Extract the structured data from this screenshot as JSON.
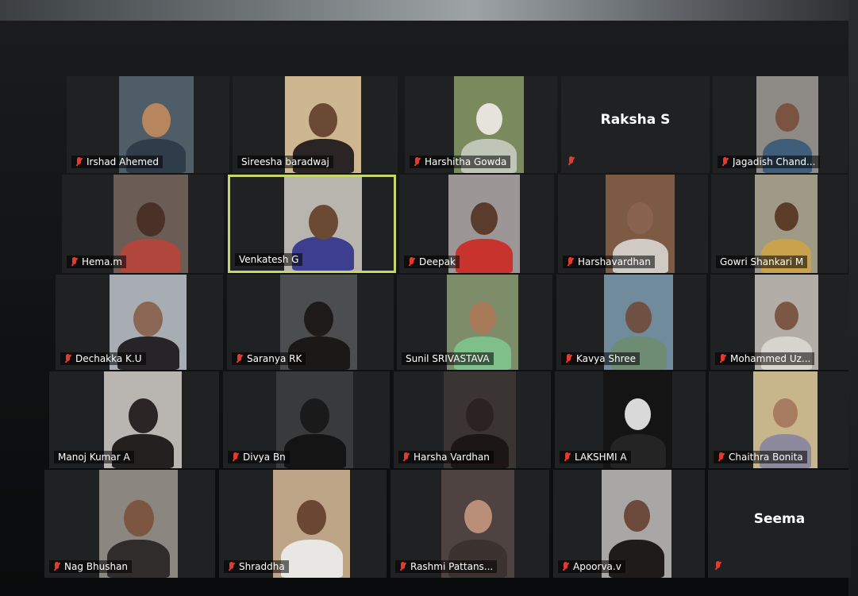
{
  "meeting": {
    "participants": [
      {
        "name": "Irshad Ahemed",
        "muted": true,
        "bg": "#4f5e66",
        "skin": "#b7855e",
        "shirt": "#2f3d4a"
      },
      {
        "name": "Sireesha baradwaj",
        "muted": false,
        "bg": "#cdb690",
        "skin": "#6a4a35",
        "shirt": "#2a2524"
      },
      {
        "name": "Harshitha Gowda",
        "muted": true,
        "bg": "#7a8a5c",
        "skin": "#e6e3dd",
        "shirt": "#c0c6b7"
      },
      {
        "name": "Raksha S",
        "muted": true,
        "video_off": true
      },
      {
        "name": "Jagadish Chand...",
        "muted": true,
        "bg": "#8e8b86",
        "skin": "#7a5441",
        "shirt": "#3e5e7c"
      },
      {
        "name": "Hema.m",
        "muted": true,
        "bg": "#6b5d55",
        "skin": "#4a3127",
        "shirt": "#b1463d"
      },
      {
        "name": "Venkatesh G",
        "muted": false,
        "active": true,
        "bg": "#b8b4ae",
        "skin": "#6b4a34",
        "shirt": "#3d3e8f"
      },
      {
        "name": "Deepak",
        "muted": true,
        "bg": "#9c9796",
        "skin": "#5a3c2c",
        "shirt": "#c9332e"
      },
      {
        "name": "Harshavardhan",
        "muted": true,
        "bg": "#7c5a44",
        "skin": "#8a6350",
        "shirt": "#cfcbc4"
      },
      {
        "name": "Gowri Shankari M",
        "muted": false,
        "bg": "#9f9a86",
        "skin": "#5b3d2a",
        "shirt": "#c9a24b"
      },
      {
        "name": "Dechakka K.U",
        "muted": true,
        "bg": "#a7adb2",
        "skin": "#8a6655",
        "shirt": "#262426"
      },
      {
        "name": "Saranya RK",
        "muted": true,
        "bg": "#4b4d4e",
        "skin": "#1d1a19",
        "shirt": "#1b1918"
      },
      {
        "name": "Sunil SRIVASTAVA",
        "muted": false,
        "bg": "#7d8d6a",
        "skin": "#a77a5a",
        "shirt": "#7fbf8a"
      },
      {
        "name": "Kavya Shree",
        "muted": true,
        "bg": "#6f8b9c",
        "skin": "#6e5142",
        "shirt": "#6d8c73"
      },
      {
        "name": "Mohammed Uz...",
        "muted": true,
        "bg": "#b3ada8",
        "skin": "#7b5843",
        "shirt": "#d7d3cd"
      },
      {
        "name": "Manoj Kumar A",
        "muted": false,
        "bg": "#b9b6b2",
        "skin": "#2b2625",
        "shirt": "#232020"
      },
      {
        "name": "Divya Bn",
        "muted": true,
        "bg": "#383a3c",
        "skin": "#1b1a1a",
        "shirt": "#151414"
      },
      {
        "name": "Harsha Vardhan",
        "muted": true,
        "bg": "#3a3432",
        "skin": "#2a2321",
        "shirt": "#1c1716"
      },
      {
        "name": "LAKSHMI A",
        "muted": true,
        "bg": "#141414",
        "skin": "#d9d9d9",
        "shirt": "#242424"
      },
      {
        "name": "Chaithra Bonita",
        "muted": true,
        "bg": "#c7b68c",
        "skin": "#a77b5f",
        "shirt": "#8e8a9e"
      },
      {
        "name": "Nag Bhushan",
        "muted": true,
        "bg": "#8b8780",
        "skin": "#7d5642",
        "shirt": "#2f2c2b"
      },
      {
        "name": "Shraddha",
        "muted": true,
        "bg": "#bfa587",
        "skin": "#6a4732",
        "shirt": "#e9e7e3"
      },
      {
        "name": "Rashmi Pattans...",
        "muted": true,
        "bg": "#4e4340",
        "skin": "#b98f79",
        "shirt": "#3c3331"
      },
      {
        "name": "Apoorva.v",
        "muted": true,
        "bg": "#a8a7a5",
        "skin": "#6c4a3b",
        "shirt": "#1e1b1a"
      },
      {
        "name": "Seema",
        "muted": true,
        "video_off": true
      }
    ]
  }
}
